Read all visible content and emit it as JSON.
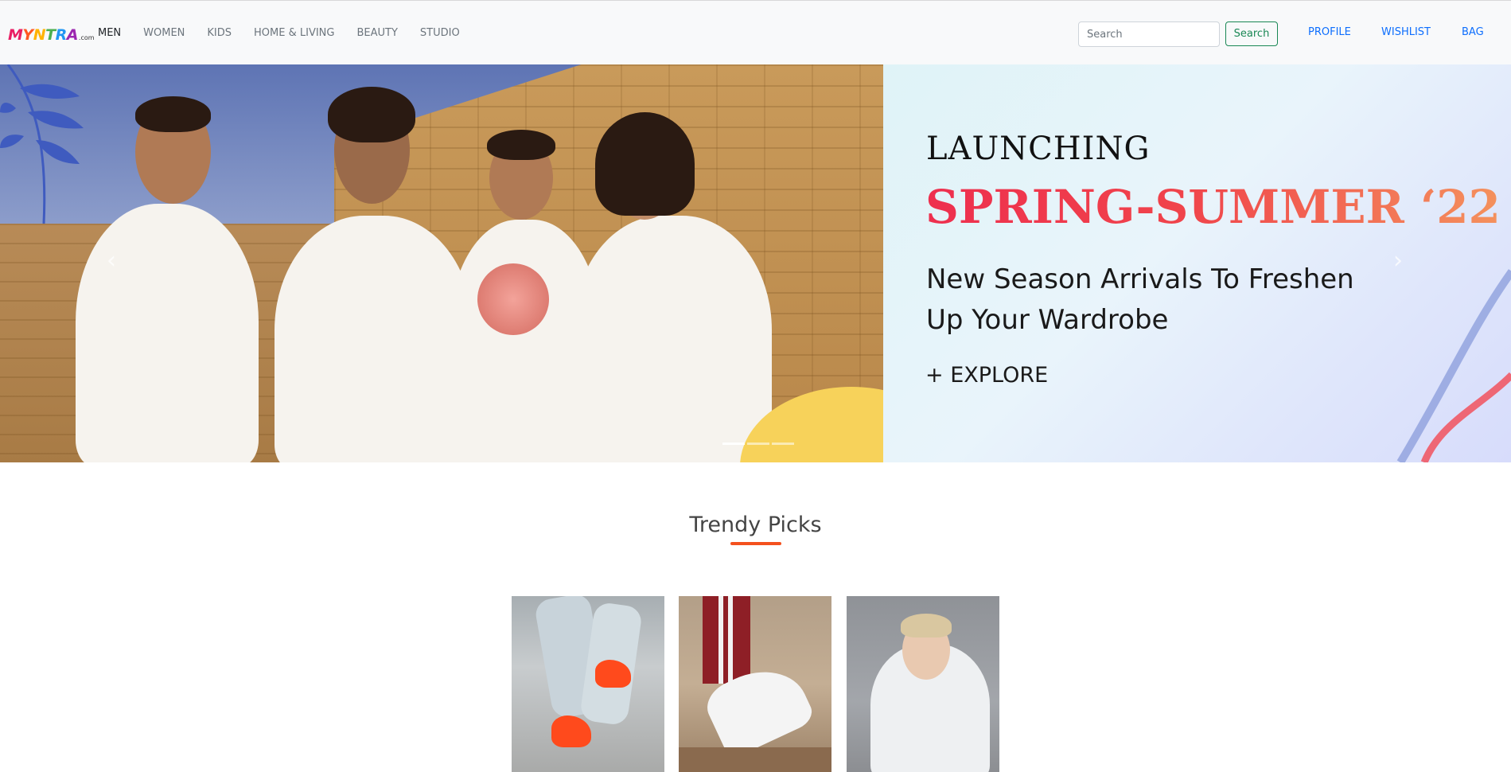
{
  "brand": {
    "logo_letters": [
      "M",
      "Y",
      "N",
      "T",
      "R",
      "A"
    ],
    "logo_suffix": ".com"
  },
  "nav": {
    "items": [
      {
        "label": "MEN",
        "active": true
      },
      {
        "label": "WOMEN",
        "active": false
      },
      {
        "label": "KIDS",
        "active": false
      },
      {
        "label": "HOME & LIVING",
        "active": false
      },
      {
        "label": "BEAUTY",
        "active": false
      },
      {
        "label": "STUDIO",
        "active": false
      }
    ]
  },
  "search": {
    "placeholder": "Search",
    "button_label": "Search"
  },
  "account_links": {
    "profile": "PROFILE",
    "wishlist": "WISHLIST",
    "bag": "BAG"
  },
  "hero": {
    "launch": "LAUNCHING",
    "title": "SPRING-SUMMER ‘22",
    "subtitle": "New Season Arrivals To Freshen Up Your Wardrobe",
    "cta": "+ EXPLORE",
    "prev_icon": "‹",
    "next_icon": "›",
    "slide_count": 3,
    "active_slide": 1
  },
  "trendy": {
    "title": "Trendy Picks",
    "cards": [
      {
        "icon": "orange-sneakers-photo"
      },
      {
        "icon": "striped-sneaker-photo"
      },
      {
        "icon": "white-hoodie-photo"
      }
    ]
  },
  "colors": {
    "nav_bg": "#f8f9fa",
    "search_green": "#198754",
    "link_blue": "#0d6efd",
    "accent_underline": "#f4511e",
    "title_red": "#ee2f4e",
    "title_orange": "#f4915d"
  }
}
